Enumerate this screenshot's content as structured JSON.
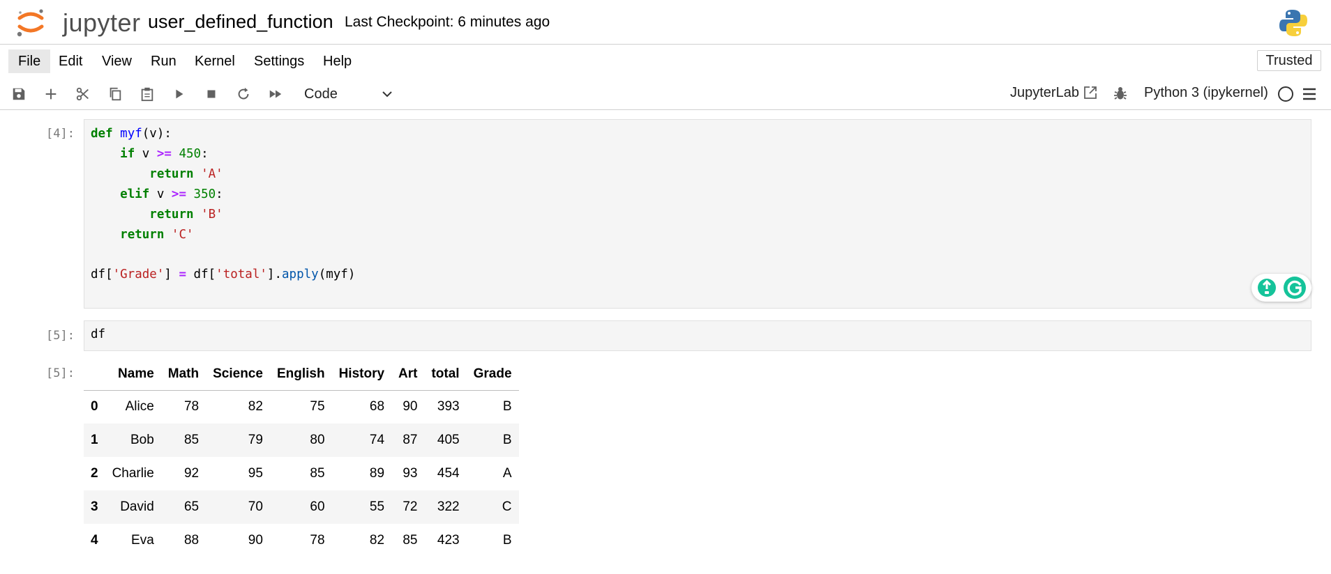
{
  "header": {
    "logo_text": "jupyter",
    "notebook_title": "user_defined_function",
    "checkpoint": "Last Checkpoint: 6 minutes ago"
  },
  "menu": {
    "items": [
      "File",
      "Edit",
      "View",
      "Run",
      "Kernel",
      "Settings",
      "Help"
    ],
    "active": "File",
    "trusted": "Trusted"
  },
  "toolbar": {
    "icons": [
      "save-icon",
      "add-cell-icon",
      "cut-icon",
      "copy-icon",
      "paste-icon",
      "run-icon",
      "stop-icon",
      "restart-icon",
      "fast-forward-icon"
    ],
    "cell_type": "Code",
    "jupyterlab_label": "JupyterLab",
    "kernel_name": "Python 3 (ipykernel)"
  },
  "cells": [
    {
      "prompt": "[4]:",
      "lines": [
        "def myf(v):",
        "    if v >= 450:",
        "        return 'A'",
        "    elif v >= 350:",
        "        return 'B'",
        "    return 'C'",
        "",
        "df['Grade'] = df['total'].apply(myf)"
      ]
    },
    {
      "prompt": "[5]:",
      "lines": [
        "df"
      ]
    }
  ],
  "output": {
    "prompt": "[5]:",
    "columns": [
      "",
      "Name",
      "Math",
      "Science",
      "English",
      "History",
      "Art",
      "total",
      "Grade"
    ],
    "rows": [
      [
        "0",
        "Alice",
        "78",
        "82",
        "75",
        "68",
        "90",
        "393",
        "B"
      ],
      [
        "1",
        "Bob",
        "85",
        "79",
        "80",
        "74",
        "87",
        "405",
        "B"
      ],
      [
        "2",
        "Charlie",
        "92",
        "95",
        "85",
        "89",
        "93",
        "454",
        "A"
      ],
      [
        "3",
        "David",
        "65",
        "70",
        "60",
        "55",
        "72",
        "322",
        "C"
      ],
      [
        "4",
        "Eva",
        "88",
        "90",
        "78",
        "82",
        "85",
        "423",
        "B"
      ]
    ]
  },
  "colors": {
    "jupyter_orange": "#f37726",
    "keyword": "#008000",
    "string": "#ba2121",
    "grammarly_green": "#15c39a"
  }
}
